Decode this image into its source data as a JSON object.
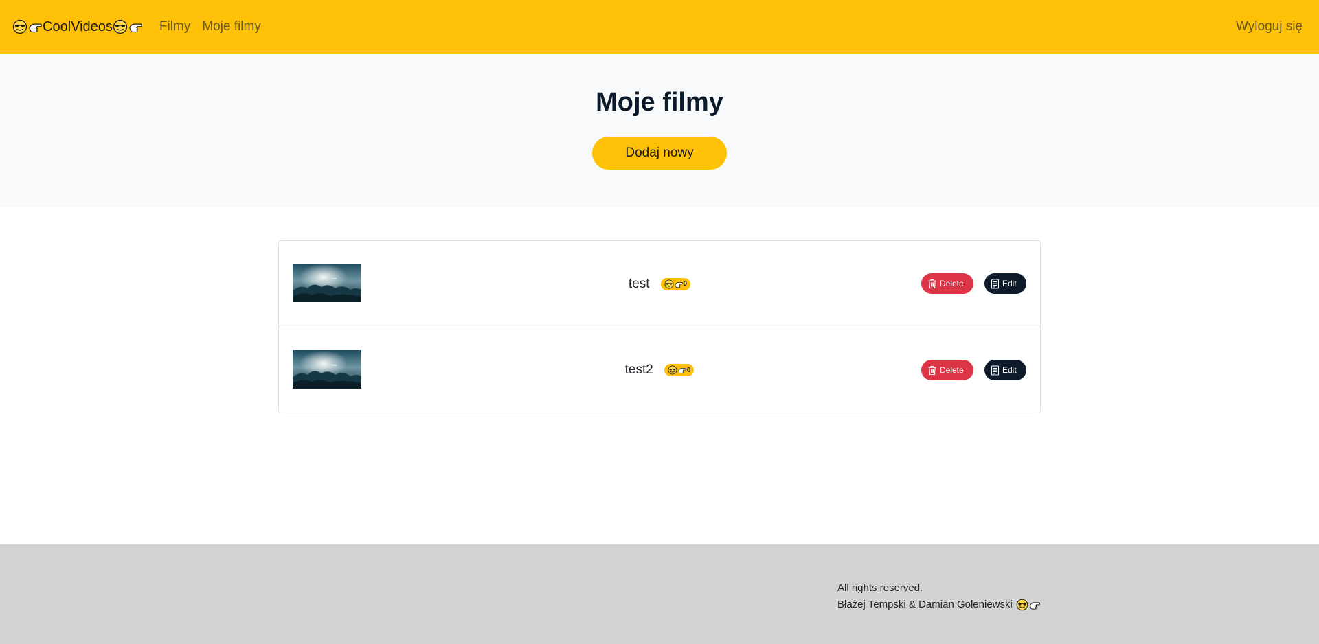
{
  "navbar": {
    "brand": "CoolVideos",
    "links": [
      "Filmy",
      "Moje filmy"
    ],
    "logout": "Wyloguj się",
    "bg_color": "#ffc107"
  },
  "hero": {
    "title": "Moje filmy",
    "add_button": "Dodaj nowy"
  },
  "videos": [
    {
      "title": "test",
      "likes": "0",
      "delete_label": "Delete",
      "edit_label": "Edit"
    },
    {
      "title": "test2",
      "likes": "0",
      "delete_label": "Delete",
      "edit_label": "Edit"
    }
  ],
  "footer": {
    "rights": "All rights reserved.",
    "authors": "Błażej Tempski & Damian Goleniewski"
  },
  "colors": {
    "accent": "#ffc107",
    "danger": "#dc3545",
    "dark": "#0d1b2a",
    "footer_bg": "#d3d3d3"
  },
  "icons": [
    "sunglasses-face-icon",
    "pointing-hand-icon",
    "trash-icon",
    "document-icon"
  ]
}
